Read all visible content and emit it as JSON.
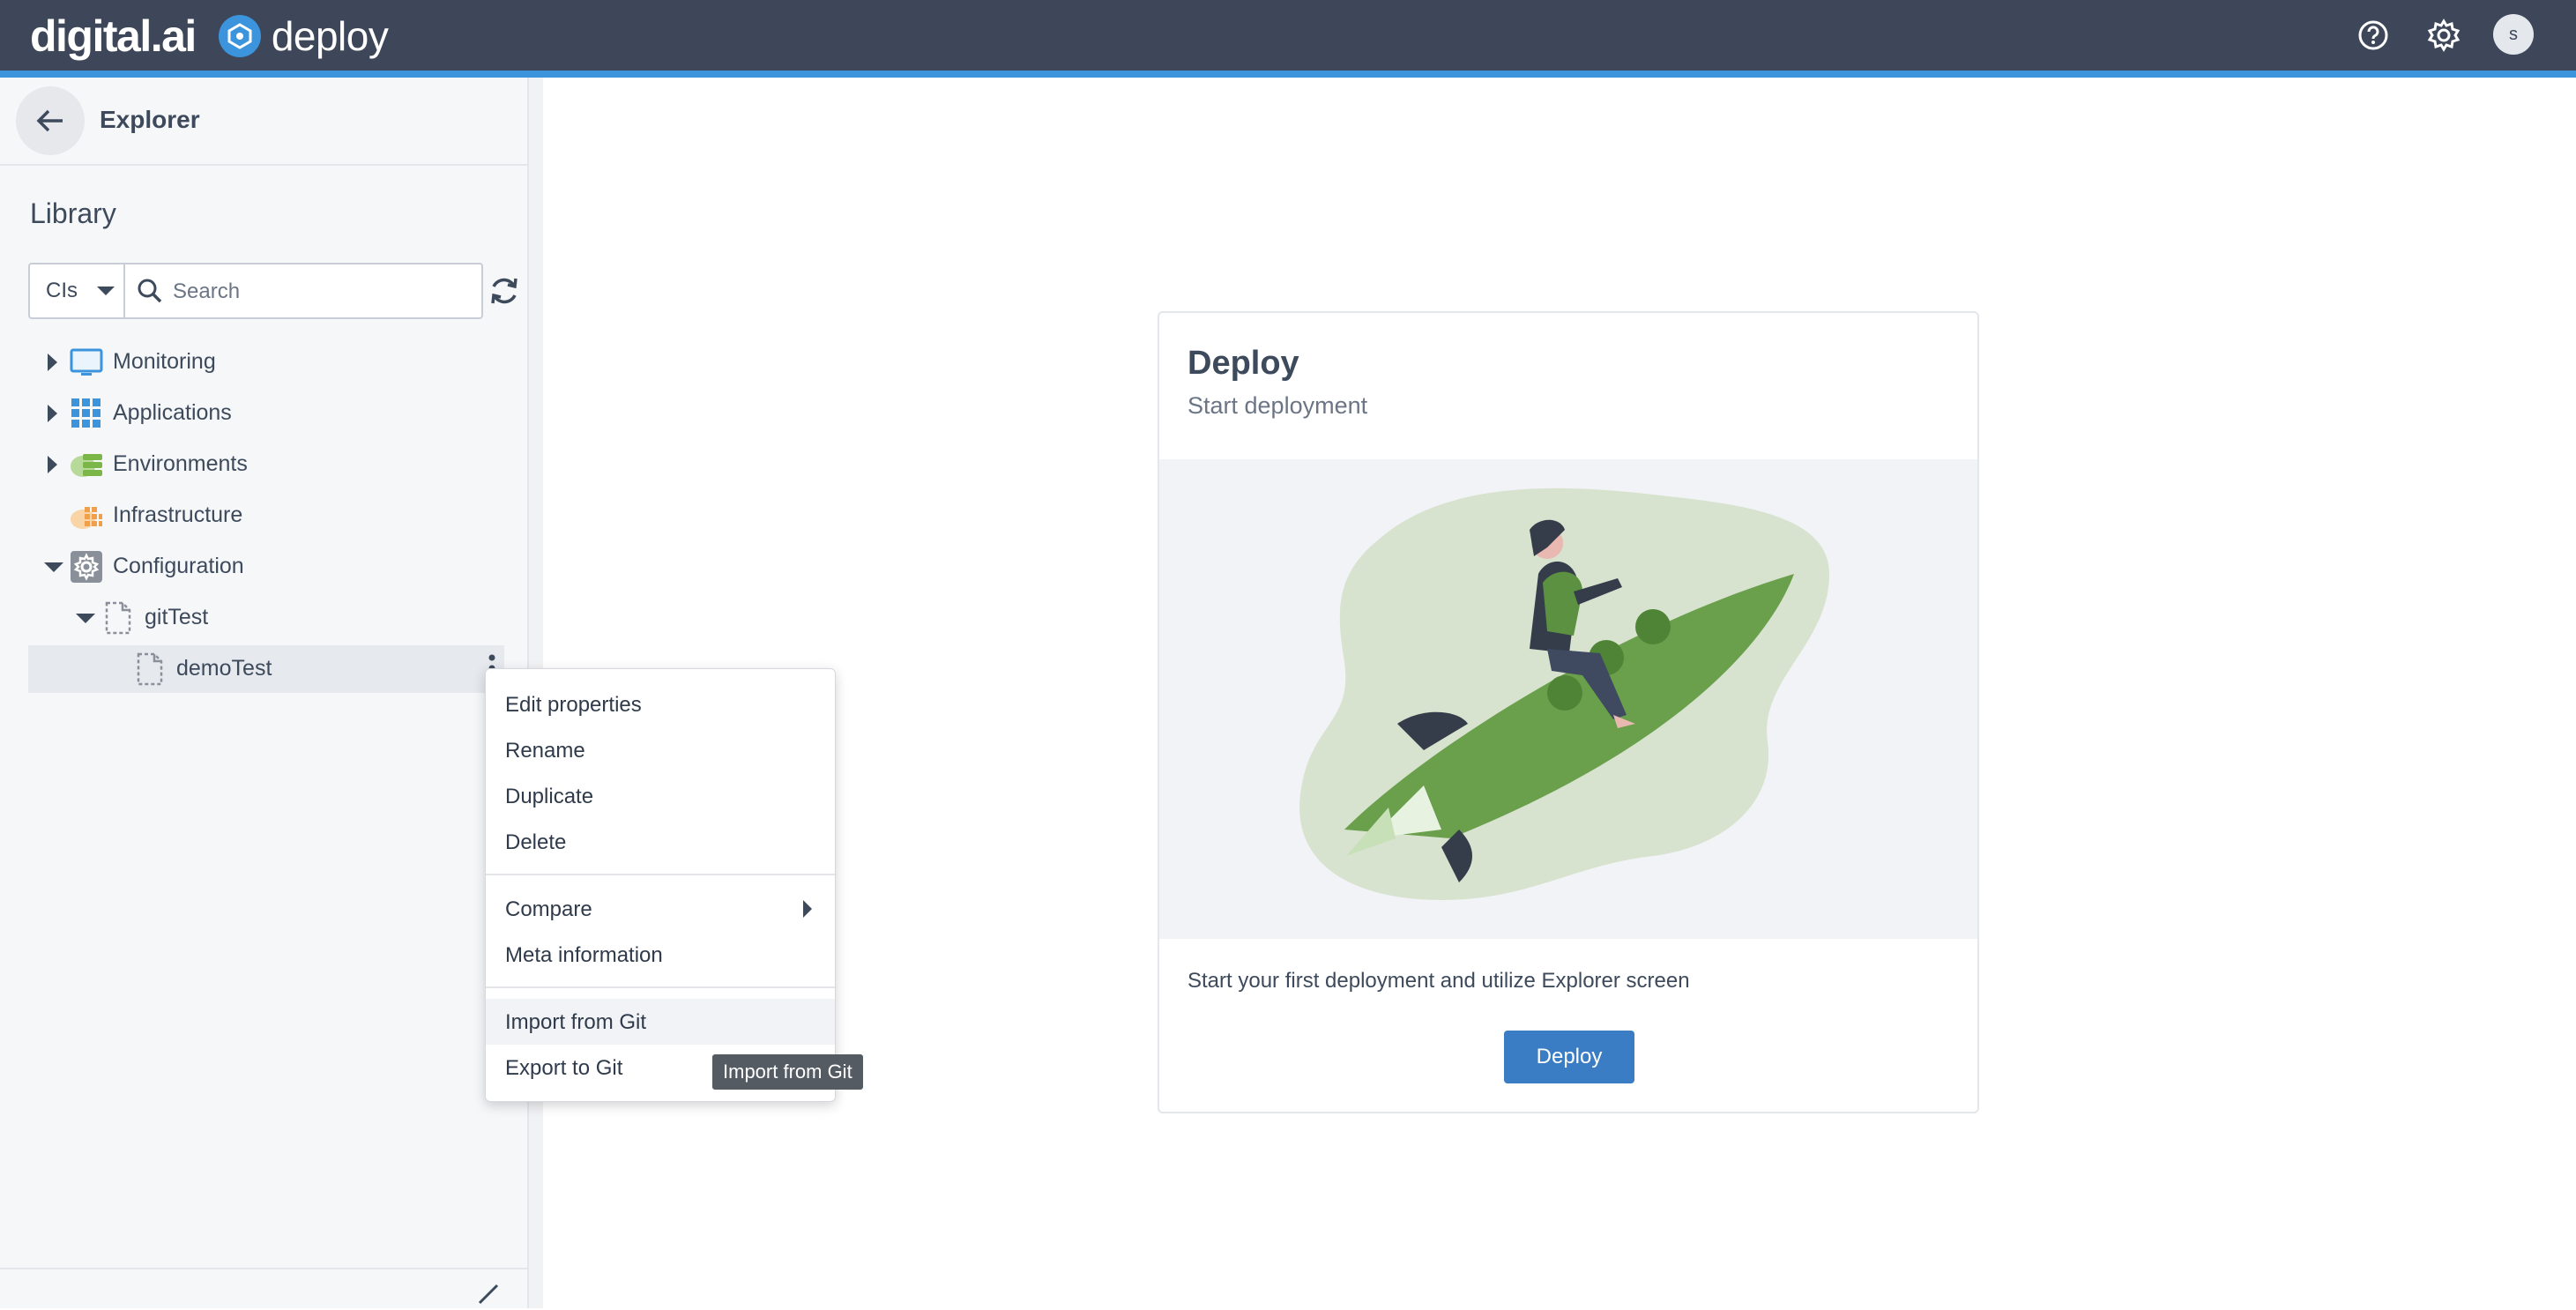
{
  "header": {
    "brand_left": "digital.ai",
    "brand_product": "deploy",
    "help_icon": "help-circle-icon",
    "settings_icon": "gear-icon",
    "avatar_letter": "s",
    "colors": {
      "bar": "#3d4759",
      "accent": "#3b94dc"
    }
  },
  "sidebar": {
    "title": "Explorer",
    "section_title": "Library",
    "filter": {
      "selected": "CIs",
      "search_placeholder": "Search"
    },
    "tree": [
      {
        "label": "Monitoring",
        "icon": "monitor-icon",
        "expanded": false
      },
      {
        "label": "Applications",
        "icon": "apps-grid-icon",
        "expanded": false
      },
      {
        "label": "Environments",
        "icon": "environments-icon",
        "expanded": false
      },
      {
        "label": "Infrastructure",
        "icon": "infrastructure-icon"
      },
      {
        "label": "Configuration",
        "icon": "configuration-gear-icon",
        "expanded": true
      },
      {
        "label": "gitTest",
        "icon": "file-dashed-icon",
        "expanded": true
      },
      {
        "label": "demoTest",
        "icon": "file-dashed-icon",
        "selected": true
      }
    ]
  },
  "context_menu": {
    "items": [
      {
        "label": "Edit properties"
      },
      {
        "label": "Rename"
      },
      {
        "label": "Duplicate"
      },
      {
        "label": "Delete"
      },
      {
        "label": "Compare",
        "submenu": true
      },
      {
        "label": "Meta information"
      },
      {
        "label": "Import from Git",
        "hovered": true
      },
      {
        "label": "Export to Git"
      }
    ],
    "tooltip": "Import from Git"
  },
  "main": {
    "card": {
      "title": "Deploy",
      "subtitle": "Start deployment",
      "description": "Start your first deployment and utilize Explorer screen",
      "button_label": "Deploy",
      "illustration": "rocket-rider-illustration"
    }
  }
}
